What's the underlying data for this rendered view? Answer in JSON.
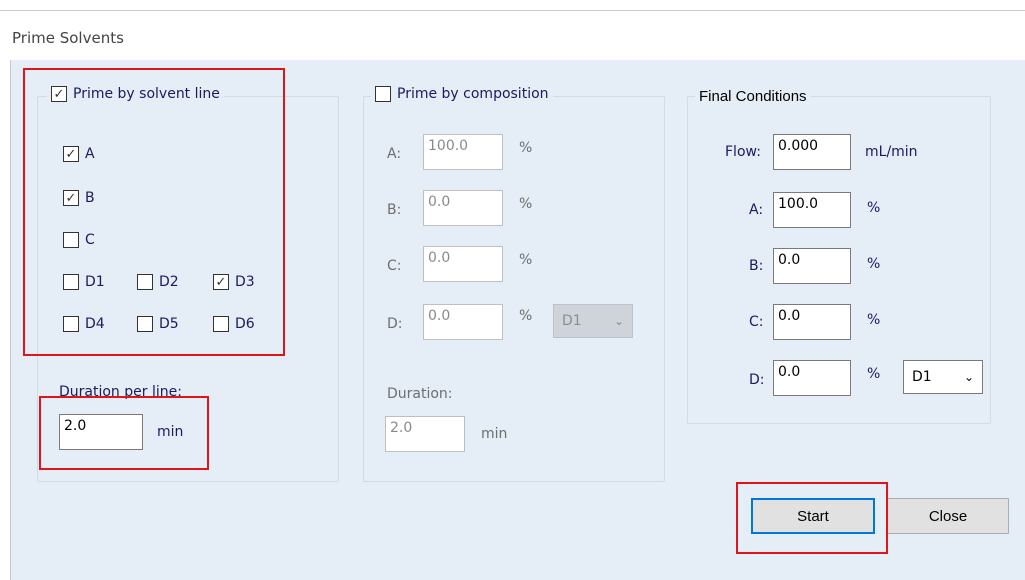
{
  "window": {
    "title": "Prime Solvents"
  },
  "solvent_line": {
    "legend": "Prime by solvent line",
    "checked": true,
    "lines": [
      {
        "label": "A",
        "checked": true
      },
      {
        "label": "B",
        "checked": true
      },
      {
        "label": "C",
        "checked": false
      },
      {
        "label": "D1",
        "checked": false
      },
      {
        "label": "D2",
        "checked": false
      },
      {
        "label": "D3",
        "checked": true
      },
      {
        "label": "D4",
        "checked": false
      },
      {
        "label": "D5",
        "checked": false
      },
      {
        "label": "D6",
        "checked": false
      }
    ],
    "duration_label": "Duration per line:",
    "duration_value": "2.0",
    "duration_unit": "min"
  },
  "composition": {
    "legend": "Prime by composition",
    "checked": false,
    "rows": [
      {
        "label": "A:",
        "value": "100.0",
        "unit": "%"
      },
      {
        "label": "B:",
        "value": "0.0",
        "unit": "%"
      },
      {
        "label": "C:",
        "value": "0.0",
        "unit": "%"
      },
      {
        "label": "D:",
        "value": "0.0",
        "unit": "%"
      }
    ],
    "d_select": "D1",
    "duration_label": "Duration:",
    "duration_value": "2.0",
    "duration_unit": "min"
  },
  "final_conditions": {
    "legend": "Final Conditions",
    "flow_label": "Flow:",
    "flow_value": "0.000",
    "flow_unit": "mL/min",
    "rows": [
      {
        "label": "A:",
        "value": "100.0",
        "unit": "%"
      },
      {
        "label": "B:",
        "value": "0.0",
        "unit": "%"
      },
      {
        "label": "C:",
        "value": "0.0",
        "unit": "%"
      },
      {
        "label": "D:",
        "value": "0.0",
        "unit": "%"
      }
    ],
    "d_select": "D1"
  },
  "buttons": {
    "start": "Start",
    "close": "Close"
  },
  "colors": {
    "background": "#e5edf6",
    "highlight": "#e0141b",
    "default_button_border": "#0078d7"
  }
}
